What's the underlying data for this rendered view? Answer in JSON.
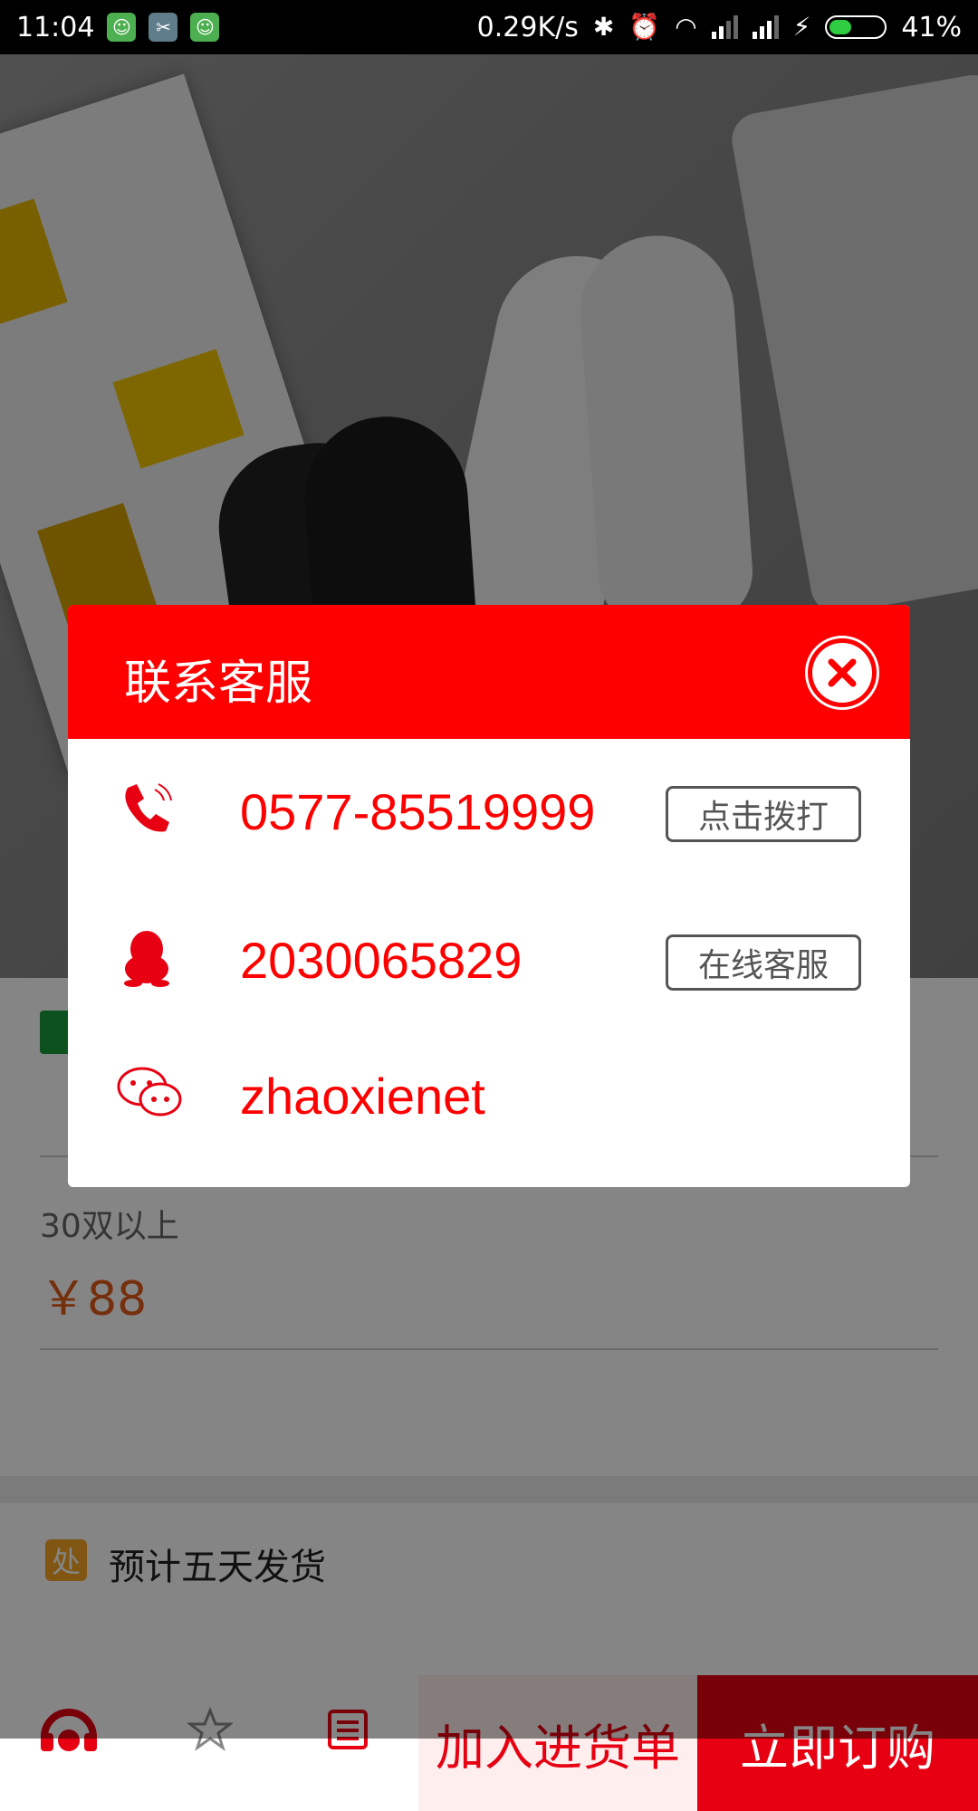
{
  "status_bar": {
    "time": "11:04",
    "net_speed": "0.29K/s",
    "battery": "41%",
    "battery_level": 0.41
  },
  "product": {
    "tier_label": "30双以上",
    "tier_price": "￥88",
    "shipping_icon": "处",
    "shipping_text": "预计五天发货"
  },
  "bottom_bar": {
    "add_to_cart": "加入进货单",
    "buy_now": "立即订购"
  },
  "dialog": {
    "title": "联系客服",
    "phone": "0577-85519999",
    "phone_action": "点击拨打",
    "qq": "2030065829",
    "qq_action": "在线客服",
    "wechat": "zhaoxienet"
  },
  "colors": {
    "accent": "#ff0000",
    "price": "#e05a1a"
  }
}
